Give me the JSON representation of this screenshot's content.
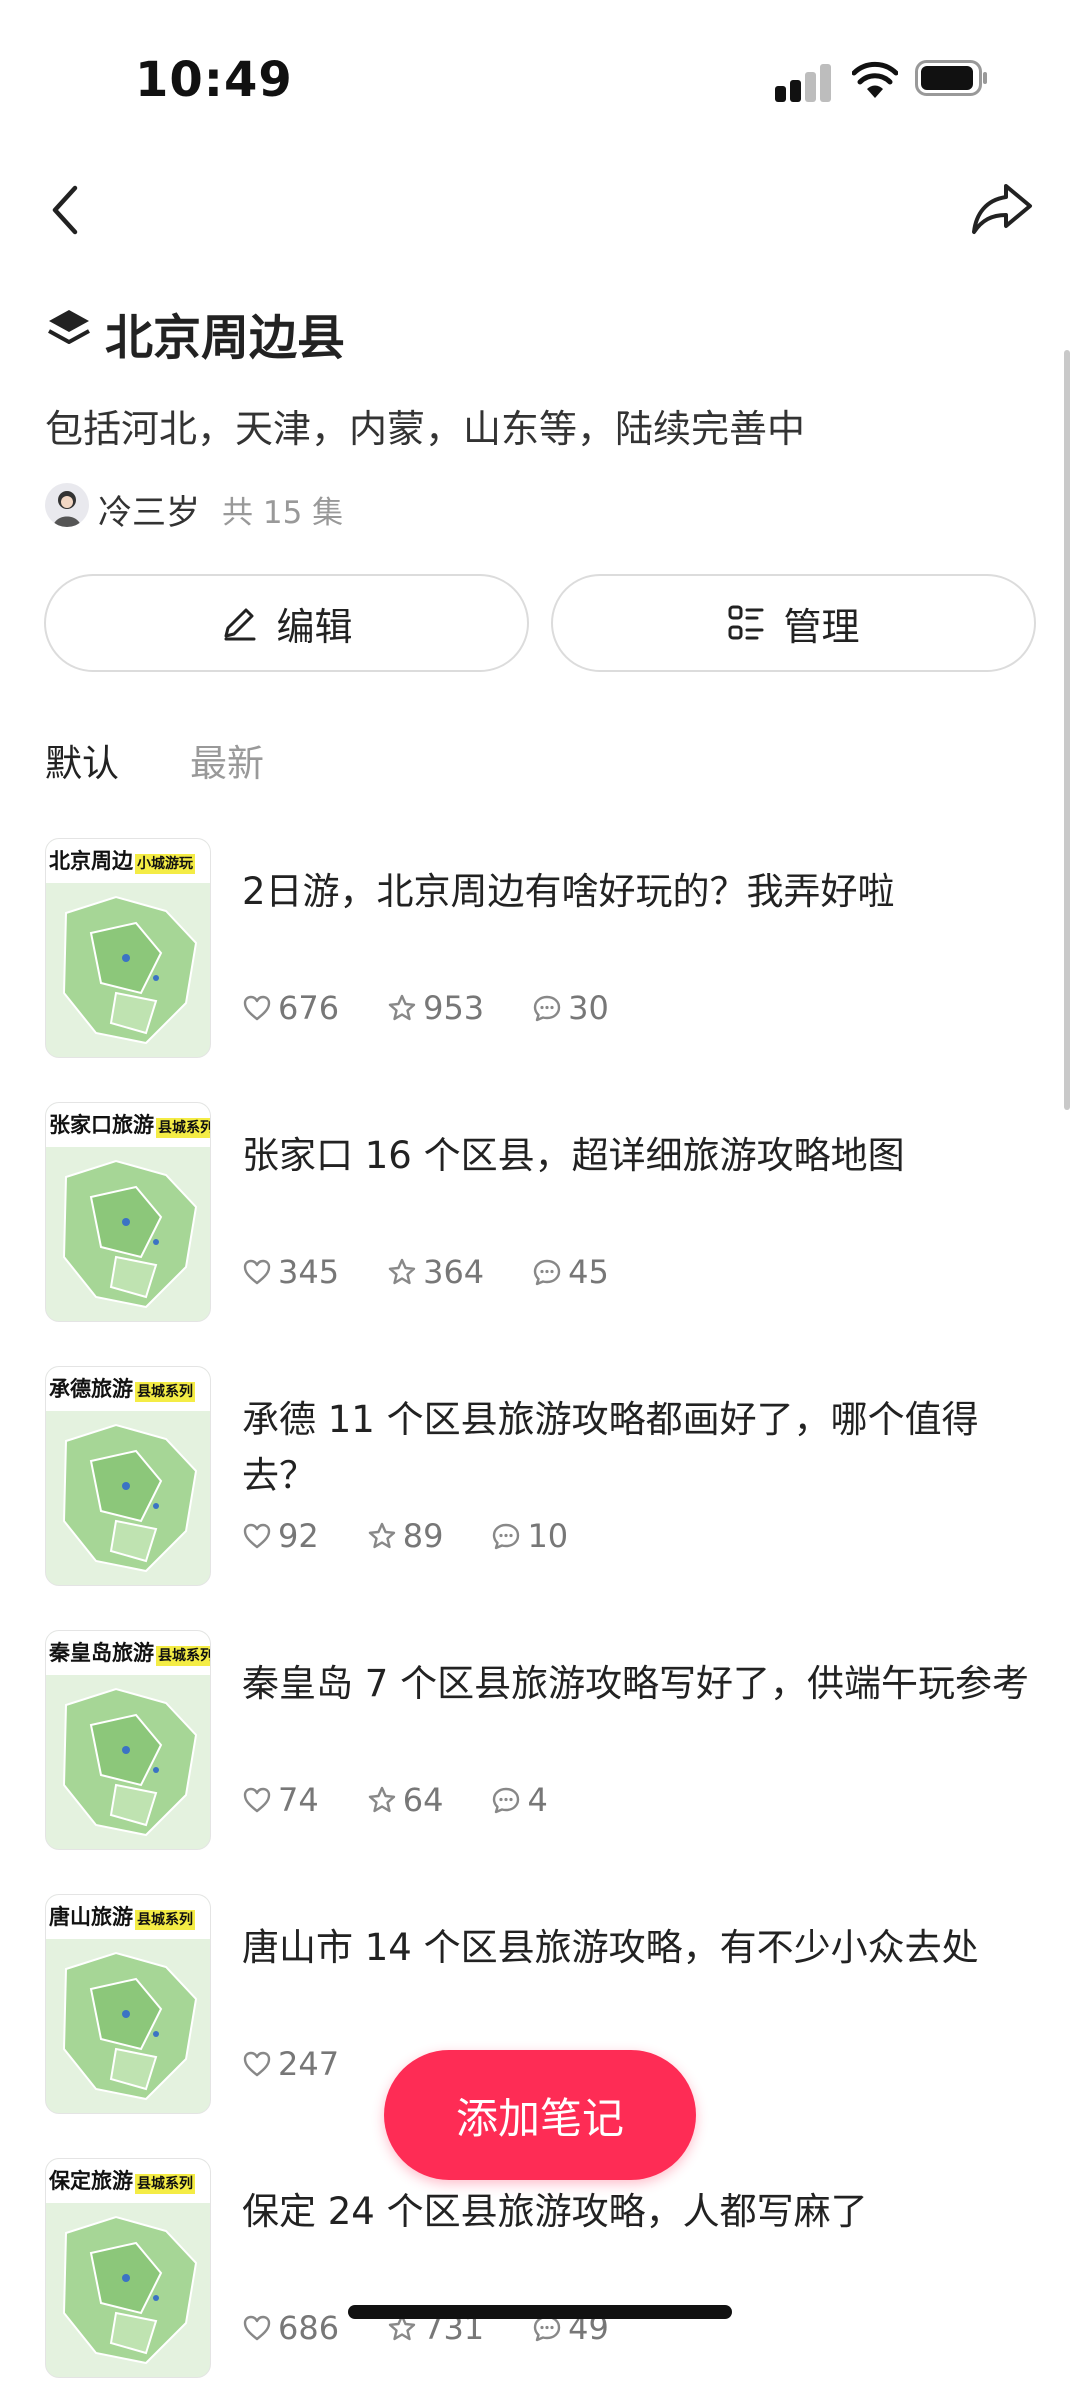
{
  "status_bar": {
    "time": "10:49",
    "signal_icon": "cellular-signal-icon",
    "wifi_icon": "wifi-icon",
    "battery_icon": "battery-icon"
  },
  "nav": {
    "back_icon": "chevron-left-icon",
    "share_icon": "share-arrow-icon"
  },
  "collection": {
    "icon": "layers-icon",
    "title": "北京周边县",
    "description": "包括河北，天津，内蒙，山东等，陆续完善中",
    "author": "冷三岁",
    "episode_count": "共 15 集"
  },
  "actions": {
    "edit_label": "编辑",
    "manage_label": "管理"
  },
  "tabs": [
    {
      "label": "默认",
      "active": true
    },
    {
      "label": "最新",
      "active": false
    }
  ],
  "notes": [
    {
      "thumb_title": "北京周边",
      "thumb_tag": "小城游玩",
      "title": "2日游，北京周边有啥好玩的？我弄好啦",
      "likes": "676",
      "stars": "953",
      "comments": "30"
    },
    {
      "thumb_title": "张家口旅游",
      "thumb_tag": "县城系列",
      "title": "张家口 16 个区县，超详细旅游攻略地图",
      "likes": "345",
      "stars": "364",
      "comments": "45"
    },
    {
      "thumb_title": "承德旅游",
      "thumb_tag": "县城系列",
      "title": "承德 11 个区县旅游攻略都画好了，哪个值得去？",
      "likes": "92",
      "stars": "89",
      "comments": "10"
    },
    {
      "thumb_title": "秦皇岛旅游",
      "thumb_tag": "县城系列",
      "title": "秦皇岛 7 个区县旅游攻略写好了，供端午玩参考",
      "likes": "74",
      "stars": "64",
      "comments": "4"
    },
    {
      "thumb_title": "唐山旅游",
      "thumb_tag": "县城系列",
      "title": "唐山市 14 个区县旅游攻略，有不少小众去处",
      "likes": "247",
      "stars": "",
      "comments": ""
    },
    {
      "thumb_title": "保定旅游",
      "thumb_tag": "县城系列",
      "title": "保定 24 个区县旅游攻略，人都写麻了",
      "likes": "686",
      "stars": "731",
      "comments": "49"
    }
  ],
  "fab": {
    "label": "添加笔记"
  },
  "colors": {
    "accent": "#fe2c55",
    "map_green": "#9fd28f",
    "map_light": "#dcefd6"
  }
}
